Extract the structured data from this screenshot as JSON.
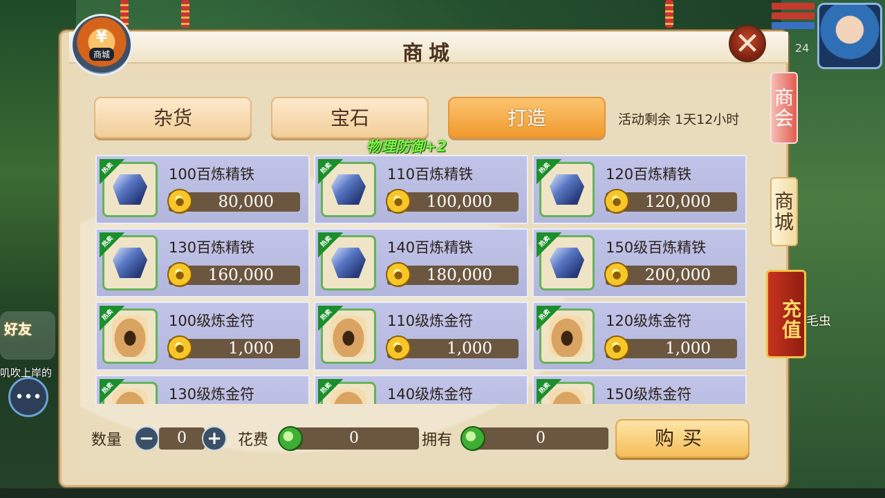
{
  "window": {
    "title": "商城",
    "emblem_label": "商城",
    "emblem_symbol": "¥",
    "close_symbol": "✕"
  },
  "tabs": [
    {
      "label": "杂货",
      "active": false
    },
    {
      "label": "宝石",
      "active": false
    },
    {
      "label": "打造",
      "active": true
    }
  ],
  "countdown": "活动剩余 1天12小时",
  "float_effect": "物理防御+2",
  "items": [
    {
      "name": "100百炼精铁",
      "price": "80,000",
      "icon": "iron-ore-icon",
      "hot": "热卖"
    },
    {
      "name": "110百炼精铁",
      "price": "100,000",
      "icon": "iron-ore-icon",
      "hot": "热卖"
    },
    {
      "name": "120百炼精铁",
      "price": "120,000",
      "icon": "iron-ore-icon",
      "hot": "热卖"
    },
    {
      "name": "130百炼精铁",
      "price": "160,000",
      "icon": "iron-ore-icon",
      "hot": "热卖"
    },
    {
      "name": "140百炼精铁",
      "price": "180,000",
      "icon": "iron-ore-icon",
      "hot": "热卖"
    },
    {
      "name": "150级百炼精铁",
      "price": "200,000",
      "icon": "iron-ore-icon",
      "hot": "热卖"
    },
    {
      "name": "100级炼金符",
      "price": "1,000",
      "icon": "alchemy-scroll-icon",
      "hot": "热卖"
    },
    {
      "name": "110级炼金符",
      "price": "1,000",
      "icon": "alchemy-scroll-icon",
      "hot": "热卖"
    },
    {
      "name": "120级炼金符",
      "price": "1,000",
      "icon": "alchemy-scroll-icon",
      "hot": "热卖"
    },
    {
      "name": "130级炼金符",
      "price": "",
      "icon": "alchemy-scroll-icon",
      "hot": "热卖"
    },
    {
      "name": "140级炼金符",
      "price": "",
      "icon": "alchemy-scroll-icon",
      "hot": "热卖"
    },
    {
      "name": "150级炼金符",
      "price": "",
      "icon": "alchemy-scroll-icon",
      "hot": "热卖"
    }
  ],
  "purchase": {
    "quantity_label": "数量",
    "quantity": "0",
    "minus": "−",
    "plus": "+",
    "cost_label": "花费",
    "cost": "0",
    "owned_label": "拥有",
    "owned": "0",
    "buy_label": "购买"
  },
  "side_tabs": {
    "chamber": "商会",
    "store": "商城",
    "recharge": "充值"
  },
  "background": {
    "level": "24",
    "friend_badge": "好友",
    "left_text": "叽吹上岸的",
    "right_text": "的海毛虫",
    "chat_icon": "chat-bubble-icon"
  },
  "colors": {
    "active_tab": "#f09a2e",
    "item_card": "#b8bbe0",
    "hot_ribbon": "#1a8f2c",
    "float_effect": "#7ff34a",
    "recharge": "#c8331f"
  }
}
